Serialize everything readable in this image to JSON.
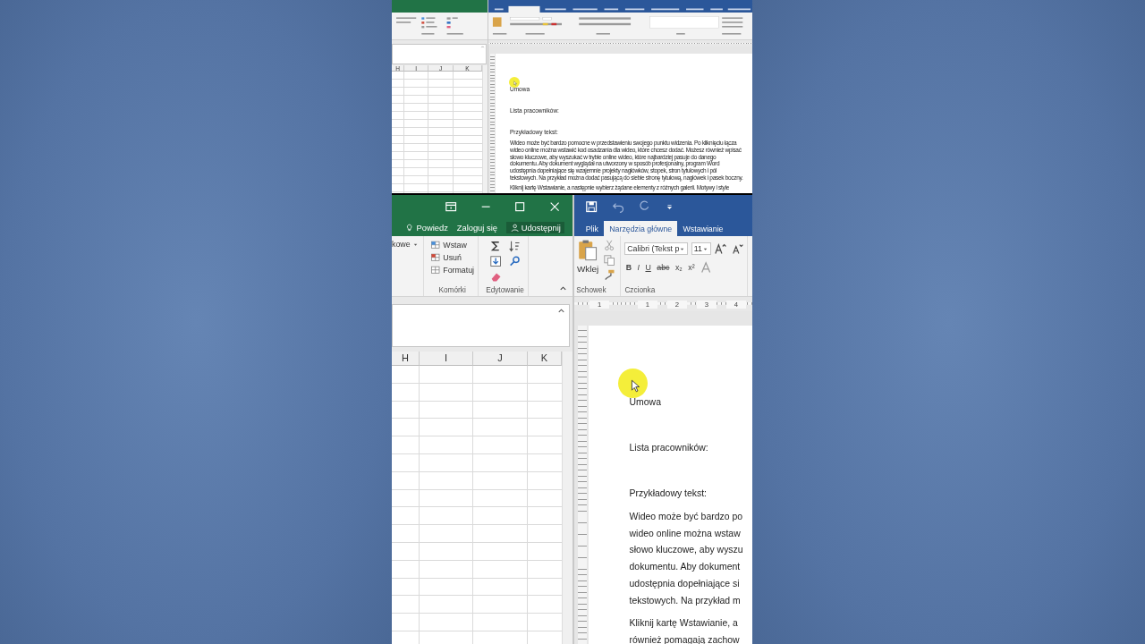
{
  "views": [
    {
      "kind": "overview",
      "excel": {
        "columns": [
          "H",
          "I",
          "J",
          "K"
        ]
      },
      "word": {
        "document": {
          "heading": "Umowa",
          "list_title": "Lista pracowników:",
          "sample_title": "Przykładowy tekst:",
          "paragraphs": [
            [
              "Wideo może być bardzo pomocne w przedstawieniu swojego punktu widzenia. Po kliknięciu łącza",
              "wideo online można wstawić kod osadzania dla wideo, które chcesz dodać. Możesz również wpisać",
              "słowo kluczowe, aby wyszukać w trybie online wideo, które najbardziej pasuje do danego",
              "dokumentu. Aby dokument wyglądał na utworzony w sposób profesjonalny, program Word",
              "udostępnia dopełniające się wzajemnie projekty nagłówków, stopek, stron tytułowych i pól",
              "tekstowych. Na przykład można dodać pasującą do siebie stronę tytułową, nagłówek i pasek boczny."
            ],
            [
              "Kliknij kartę Wstawianie, a następnie wybierz żądane elementy z różnych galerii. Motywy i style"
            ]
          ]
        }
      }
    },
    {
      "kind": "closeup",
      "excel": {
        "account_links": [
          {
            "kind": "tell",
            "label": "Powiedz"
          },
          {
            "kind": "signin",
            "label": "Zaloguj się"
          },
          {
            "kind": "share",
            "label": "Udostępnij"
          }
        ],
        "cut_label": "kowe",
        "groups": [
          {
            "kind": "cells",
            "label": "Komórki",
            "commands": [
              {
                "kind": "insert",
                "label": "Wstaw"
              },
              {
                "kind": "delete",
                "label": "Usuń"
              },
              {
                "kind": "format",
                "label": "Formatuj"
              }
            ]
          },
          {
            "kind": "editing",
            "label": "Edytowanie"
          }
        ],
        "columns": [
          "H",
          "I",
          "J",
          "K"
        ]
      },
      "word": {
        "tabs": [
          {
            "label": "Plik",
            "selected": false
          },
          {
            "label": "Narzędzia główne",
            "selected": true
          },
          {
            "label": "Wstawianie",
            "selected": false
          }
        ],
        "groups": [
          {
            "kind": "clipboard",
            "label": "Schowek",
            "paste_label": "Wklej"
          },
          {
            "kind": "font",
            "label": "Czcionka",
            "font_name": "Calibri (Tekst p",
            "font_size": "11",
            "format_buttons": [
              "B",
              "I",
              "U",
              "abc",
              "x₂",
              "x²"
            ]
          }
        ],
        "ruler_marks": [
          "1",
          "1",
          "2",
          "3",
          "4"
        ],
        "document": {
          "heading": "Umowa",
          "list_title": "Lista pracowników:",
          "sample_title": "Przykładowy tekst:",
          "paragraphs": [
            [
              "Wideo może być bardzo po",
              "wideo online można wstaw",
              "słowo kluczowe, aby wyszu",
              "dokumentu. Aby dokument",
              "udostępnia dopełniające si",
              "tekstowych. Na przykład m"
            ],
            [
              "Kliknij kartę Wstawianie, a",
              "również pomagają zachow"
            ]
          ]
        }
      }
    }
  ]
}
